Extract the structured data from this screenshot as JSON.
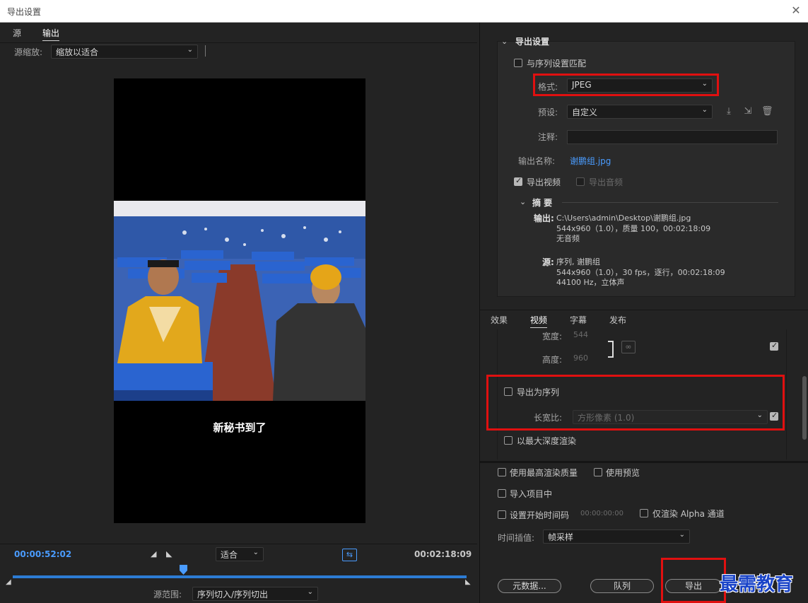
{
  "window": {
    "title": "导出设置",
    "close": "✕"
  },
  "left": {
    "tabs": [
      {
        "label": "源"
      },
      {
        "label": "输出"
      }
    ],
    "source_zoom_label": "源缩放:",
    "source_zoom_value": "缩放以适合",
    "subtitle": "新秘书到了",
    "timeline": {
      "current_time": "00:00:52:02",
      "end_time": "00:02:18:09",
      "fit_value": "适合",
      "source_range_label": "源范围:",
      "source_range_value": "序列切入/序列切出"
    }
  },
  "export_settings": {
    "section_title": "导出设置",
    "match_sequence": "与序列设置匹配",
    "format_label": "格式:",
    "format_value": "JPEG",
    "preset_label": "预设:",
    "preset_value": "自定义",
    "comment_label": "注释:",
    "comment_value": "",
    "output_name_label": "输出名称:",
    "output_name_value": "谢鹏组.jpg",
    "export_video": "导出视频",
    "export_audio": "导出音频",
    "summary_title": "摘 要",
    "summary_output_label": "输出:",
    "summary_output_line1": "C:\\Users\\admin\\Desktop\\谢鹏组.jpg",
    "summary_output_line2": "544x960（1.0），质量 100，00:02:18:09",
    "summary_output_line3": "无音频",
    "summary_source_label": "源:",
    "summary_source_line1": "序列, 谢鹏组",
    "summary_source_line2": "544x960（1.0），30 fps，逐行，00:02:18:09",
    "summary_source_line3": "44100 Hz，立体声"
  },
  "tabs2": [
    {
      "label": "效果"
    },
    {
      "label": "视频"
    },
    {
      "label": "字幕"
    },
    {
      "label": "发布"
    }
  ],
  "video": {
    "width_label": "宽度:",
    "width_value": "544",
    "height_label": "高度:",
    "height_value": "960",
    "export_as_sequence": "导出为序列",
    "aspect_label": "长宽比:",
    "aspect_value": "方形像素 (1.0)",
    "max_depth": "以最大深度渲染"
  },
  "bottom": {
    "max_quality": "使用最高渲染质量",
    "use_preview": "使用预览",
    "import_project": "导入项目中",
    "set_start_tc": "设置开始时间码",
    "start_tc_value": "00:00:00:00",
    "render_alpha": "仅渲染 Alpha 通道",
    "time_interp_label": "时间插值:",
    "time_interp_value": "帧采样",
    "metadata_btn": "元数据...",
    "queue_btn": "队列",
    "export_btn": "导出"
  },
  "watermark": "最需教育",
  "colors": {
    "accent": "#4a9cff",
    "highlight": "#e01010",
    "bg": "#232323"
  }
}
